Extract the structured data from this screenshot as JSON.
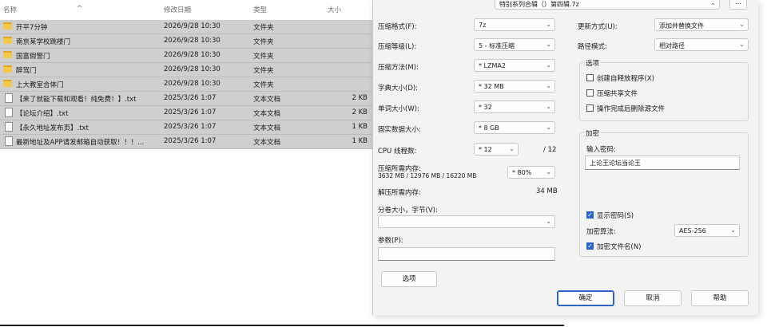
{
  "explorer": {
    "columns": {
      "name": "名称",
      "date": "修改日期",
      "type": "类型",
      "size": "大小"
    },
    "rows": [
      {
        "icon": "folder-icon",
        "name": "开平7分钟",
        "date": "2026/9/28 10:30",
        "type": "文件夹",
        "size": ""
      },
      {
        "icon": "folder-icon",
        "name": "南京某学校跳楼门",
        "date": "2026/9/28 10:30",
        "type": "文件夹",
        "size": ""
      },
      {
        "icon": "folder-icon",
        "name": "国富假警门",
        "date": "2026/9/28 10:30",
        "type": "文件夹",
        "size": ""
      },
      {
        "icon": "folder-icon",
        "name": "醉驾门",
        "date": "2026/9/28 10:30",
        "type": "文件夹",
        "size": ""
      },
      {
        "icon": "folder-icon",
        "name": "上大教室合体门",
        "date": "2026/9/28 10:30",
        "type": "文件夹",
        "size": ""
      },
      {
        "icon": "file-icon",
        "name": "【来了就能下载和观看！纯免费！】.txt",
        "date": "2025/3/26 1:07",
        "type": "文本文档",
        "size": "2 KB"
      },
      {
        "icon": "file-icon",
        "name": "【论坛介绍】.txt",
        "date": "2025/3/26 1:07",
        "type": "文本文档",
        "size": "2 KB"
      },
      {
        "icon": "file-icon",
        "name": "【永久地址发布页】.txt",
        "date": "2025/3/26 1:07",
        "type": "文本文档",
        "size": "1 KB"
      },
      {
        "icon": "file-icon",
        "name": "最新地址及APP请发邮箱自动获取！！！...",
        "date": "2025/3/26 1:07",
        "type": "文本文档",
        "size": "1 KB"
      }
    ]
  },
  "dialog": {
    "archive_path": "特别系列合辑（）第四辑.7z",
    "browse_label": "...",
    "archive_format": {
      "label": "压缩格式(F):",
      "value": "7z"
    },
    "compression_level": {
      "label": "压缩等级(L):",
      "value": "5 - 标准压缩"
    },
    "compression_method": {
      "label": "压缩方法(M):",
      "value": "* LZMA2"
    },
    "dictionary_size": {
      "label": "字典大小(D):",
      "value": "* 32 MB"
    },
    "word_size": {
      "label": "单词大小(W):",
      "value": "* 32"
    },
    "solid_block": {
      "label": "固实数据大小:",
      "value": "* 8 GB"
    },
    "cpu_threads": {
      "label": "CPU 线程数:",
      "value": "* 12",
      "total": "/ 12"
    },
    "memory_compress": {
      "label": "压缩所需内存:",
      "detail": "3632 MB / 12976 MB / 16220 MB",
      "value": "* 80%"
    },
    "memory_decompress": {
      "label": "解压所需内存:",
      "value": "34 MB"
    },
    "split_volumes": {
      "label": "分卷大小，字节(V):",
      "value": ""
    },
    "parameters": {
      "label": "参数(P):",
      "value": ""
    },
    "options_button": "选项",
    "update_mode": {
      "label": "更新方式(U):",
      "value": "添加并替换文件"
    },
    "path_mode": {
      "label": "路径模式:",
      "value": "相对路径"
    },
    "options_group": {
      "title": "选项",
      "items": [
        {
          "label": "创建自释放程序(X)",
          "checked": false
        },
        {
          "label": "压缩共享文件",
          "checked": false
        },
        {
          "label": "操作完成后删除源文件",
          "checked": false
        }
      ]
    },
    "encryption_group": {
      "title": "加密",
      "password_label": "输入密码:",
      "password_value": "上论王论坛当论王",
      "show_password": {
        "label": "显示密码(S)",
        "checked": true
      },
      "method_label": "加密算法:",
      "method_value": "AES-256",
      "encrypt_names": {
        "label": "加密文件名(N)",
        "checked": true
      }
    },
    "buttons": {
      "ok": "确定",
      "cancel": "取消",
      "help": "帮助"
    }
  }
}
